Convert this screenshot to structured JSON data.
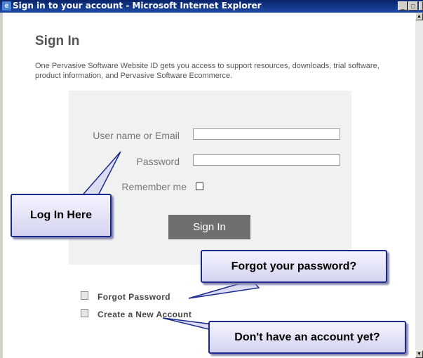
{
  "window": {
    "title": "Sign in to your account - Microsoft Internet Explorer",
    "minimize_glyph": "_",
    "maximize_glyph": "□",
    "close_glyph": "✕"
  },
  "page": {
    "heading": "Sign In",
    "intro": "One Pervasive Software Website ID gets you access to support resources, downloads, trial software, product information, and Pervasive Software Ecommerce."
  },
  "form": {
    "username_label": "User name or Email",
    "username_value": "",
    "password_label": "Password",
    "password_value": "",
    "remember_label": "Remember me",
    "remember_checked": false,
    "submit_label": "Sign In"
  },
  "links": {
    "forgot_password": "Forgot Password",
    "create_account": "Create a New Account"
  },
  "callouts": {
    "login": "Log In Here",
    "forgot": "Forgot your password?",
    "no_account": "Don't have an account yet?"
  },
  "icons": [
    "ie-icon",
    "lock-icon",
    "document-icon"
  ]
}
